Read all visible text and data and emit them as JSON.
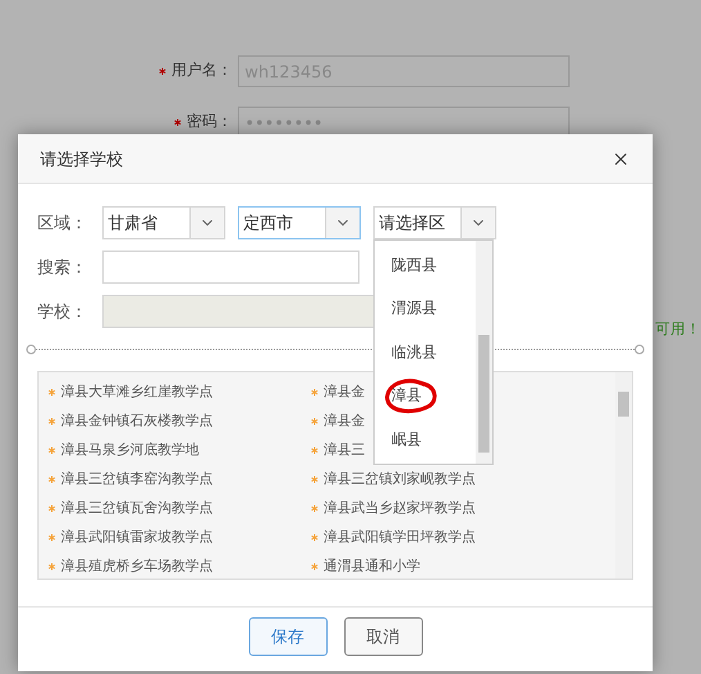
{
  "background_form": {
    "fields": [
      {
        "label": "用户名：",
        "required": true,
        "value": "wh123456"
      },
      {
        "label": "密码：",
        "required": true,
        "value": "••••••••"
      }
    ],
    "hint": "可用！"
  },
  "dialog": {
    "title": "请选择学校",
    "region": {
      "label": "区域：",
      "selects": [
        {
          "value": "甘肃省",
          "focused": false
        },
        {
          "value": "定西市",
          "focused": true
        },
        {
          "value": "请选择区",
          "focused": false
        }
      ]
    },
    "search": {
      "label": "搜索："
    },
    "school": {
      "label": "学校：",
      "disabled": true
    },
    "dropdown": {
      "options": [
        {
          "label": "陇西县",
          "circled": false
        },
        {
          "label": "渭源县",
          "circled": false
        },
        {
          "label": "临洮县",
          "circled": false
        },
        {
          "label": "漳县",
          "circled": true
        },
        {
          "label": "岷县",
          "circled": false
        }
      ]
    },
    "schools": [
      "漳县大草滩乡红崖教学点",
      "漳县金",
      "漳县金钟镇石灰楼教学点",
      "漳县金",
      "漳县马泉乡河底教学地",
      "漳县三",
      "漳县三岔镇李窑沟教学点",
      "漳县三岔镇刘家岘教学点",
      "漳县三岔镇瓦舍沟教学点",
      "漳县武当乡赵家坪教学点",
      "漳县武阳镇雷家坡教学点",
      "漳县武阳镇学田坪教学点",
      "漳县殖虎桥乡车场教学点",
      "通渭县通和小学"
    ],
    "buttons": [
      {
        "label": "保存",
        "kind": "primary"
      },
      {
        "label": "取消",
        "kind": "secondary"
      }
    ]
  }
}
